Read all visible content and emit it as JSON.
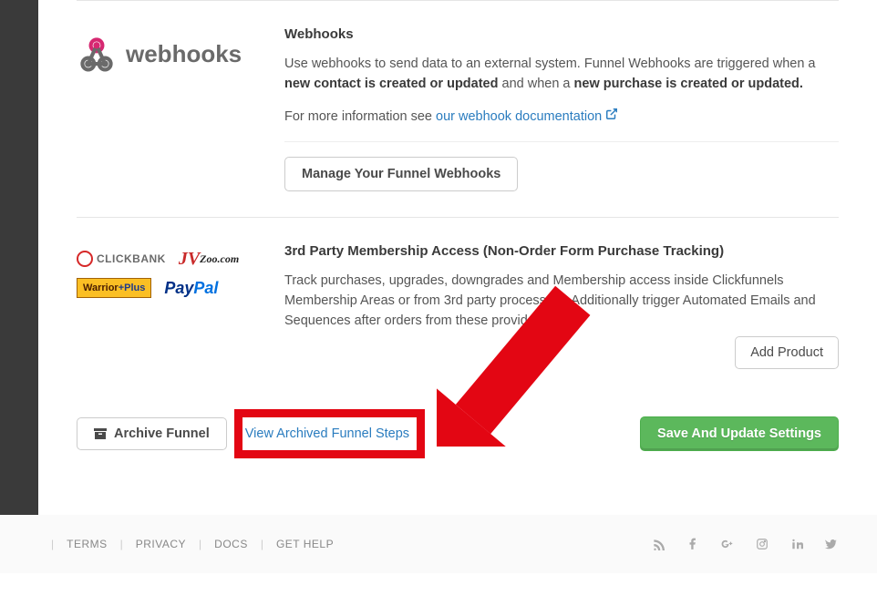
{
  "webhooks": {
    "logo_text": "webhooks",
    "title": "Webhooks",
    "desc_1a": "Use webhooks to send data to an external system. Funnel Webhooks are triggered when a ",
    "desc_1b": "new contact is created or updated",
    "desc_1c": " and when a ",
    "desc_1d": "new purchase is created or updated.",
    "desc_2a": "For more information see ",
    "doc_link_text": "our webhook documentation",
    "manage_button": "Manage Your Funnel Webhooks"
  },
  "third_party": {
    "title": "3rd Party Membership Access (Non-Order Form Purchase Tracking)",
    "desc": "Track purchases, upgrades, downgrades and Membership access inside Clickfunnels Membership Areas or from 3rd party processors. Additionally trigger Automated Emails and Sequences after orders from these providers.",
    "add_product_button": "Add Product",
    "logos": {
      "clickbank": "CLICKBANK",
      "jvzoo": "JVZoo",
      "warriorplus": "Warrior+Plus",
      "paypal_p1": "Pay",
      "paypal_p2": "Pal"
    }
  },
  "actions": {
    "archive_funnel": "Archive Funnel",
    "view_archived": "View Archived Funnel Steps",
    "save_settings": "Save And Update Settings"
  },
  "footer": {
    "links": [
      "TERMS",
      "PRIVACY",
      "DOCS",
      "GET HELP"
    ]
  }
}
